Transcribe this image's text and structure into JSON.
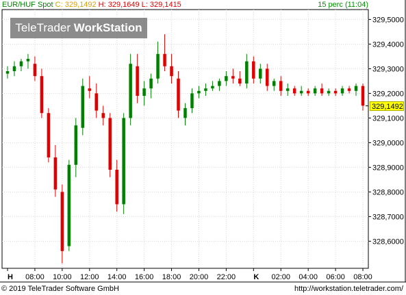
{
  "header": {
    "symbol": "EUR/HUF Spot",
    "close_label": "C:",
    "close_value": "329,1492",
    "high_label": "H:",
    "high_value": "329,1649",
    "low_label": "L:",
    "low_value": "329,1415",
    "interval": "15 perc (11:04)"
  },
  "logo": {
    "part1": "TeleTrader",
    "part2": "WorkStation"
  },
  "footer": {
    "copyright": "© 2019 TeleTrader Software GmbH",
    "url": "http://workstation.teletrader.com/"
  },
  "colors": {
    "up": "#008000",
    "down": "#e00000",
    "grid": "#d8d8d8",
    "last_price_bg": "#ffff00"
  },
  "chart_data": {
    "type": "candlestick",
    "interval": "15 perc",
    "y_ticks": [
      "329,5000",
      "329,4000",
      "329,3000",
      "329,2000",
      "329,1000",
      "329,0000",
      "328,9000",
      "328,8000",
      "328,7000",
      "328,6000"
    ],
    "ylim": [
      328.49,
      329.54
    ],
    "last_price": "329,1492",
    "x_ticks": [
      "H",
      "08:00",
      "10:00",
      "12:00",
      "14:00",
      "16:00",
      "18:00",
      "20:00",
      "22:00",
      "K",
      "02:00",
      "04:00",
      "06:00",
      "08:00"
    ],
    "candles": [
      {
        "o": 329.28,
        "h": 329.31,
        "l": 329.26,
        "c": 329.29
      },
      {
        "o": 329.29,
        "h": 329.33,
        "l": 329.27,
        "c": 329.31
      },
      {
        "o": 329.31,
        "h": 329.34,
        "l": 329.29,
        "c": 329.33
      },
      {
        "o": 329.33,
        "h": 329.36,
        "l": 329.3,
        "c": 329.34
      },
      {
        "o": 329.32,
        "h": 329.35,
        "l": 329.25,
        "c": 329.27
      },
      {
        "o": 329.27,
        "h": 329.3,
        "l": 329.1,
        "c": 329.12
      },
      {
        "o": 329.12,
        "h": 329.14,
        "l": 328.92,
        "c": 328.94
      },
      {
        "o": 328.94,
        "h": 328.99,
        "l": 328.78,
        "c": 328.81
      },
      {
        "o": 328.8,
        "h": 328.83,
        "l": 328.51,
        "c": 328.56
      },
      {
        "o": 328.58,
        "h": 328.93,
        "l": 328.56,
        "c": 328.91
      },
      {
        "o": 328.91,
        "h": 329.1,
        "l": 328.86,
        "c": 329.07
      },
      {
        "o": 329.06,
        "h": 329.26,
        "l": 329.03,
        "c": 329.23
      },
      {
        "o": 329.22,
        "h": 329.27,
        "l": 329.18,
        "c": 329.21
      },
      {
        "o": 329.2,
        "h": 329.24,
        "l": 329.1,
        "c": 329.13
      },
      {
        "o": 329.12,
        "h": 329.15,
        "l": 329.07,
        "c": 329.1
      },
      {
        "o": 329.1,
        "h": 329.12,
        "l": 328.86,
        "c": 328.89
      },
      {
        "o": 328.89,
        "h": 328.93,
        "l": 328.72,
        "c": 328.75
      },
      {
        "o": 328.75,
        "h": 329.12,
        "l": 328.71,
        "c": 329.1
      },
      {
        "o": 329.1,
        "h": 329.36,
        "l": 329.07,
        "c": 329.32
      },
      {
        "o": 329.31,
        "h": 329.36,
        "l": 329.16,
        "c": 329.19
      },
      {
        "o": 329.19,
        "h": 329.25,
        "l": 329.15,
        "c": 329.22
      },
      {
        "o": 329.22,
        "h": 329.28,
        "l": 329.18,
        "c": 329.26
      },
      {
        "o": 329.26,
        "h": 329.41,
        "l": 329.24,
        "c": 329.36
      },
      {
        "o": 329.36,
        "h": 329.44,
        "l": 329.29,
        "c": 329.31
      },
      {
        "o": 329.31,
        "h": 329.36,
        "l": 329.24,
        "c": 329.27
      },
      {
        "o": 329.26,
        "h": 329.29,
        "l": 329.1,
        "c": 329.13
      },
      {
        "o": 329.1,
        "h": 329.16,
        "l": 329.07,
        "c": 329.14
      },
      {
        "o": 329.14,
        "h": 329.22,
        "l": 329.12,
        "c": 329.2
      },
      {
        "o": 329.2,
        "h": 329.23,
        "l": 329.18,
        "c": 329.21
      },
      {
        "o": 329.21,
        "h": 329.24,
        "l": 329.19,
        "c": 329.22
      },
      {
        "o": 329.22,
        "h": 329.25,
        "l": 329.21,
        "c": 329.23
      },
      {
        "o": 329.23,
        "h": 329.26,
        "l": 329.21,
        "c": 329.25
      },
      {
        "o": 329.25,
        "h": 329.29,
        "l": 329.23,
        "c": 329.27
      },
      {
        "o": 329.27,
        "h": 329.3,
        "l": 329.24,
        "c": 329.26
      },
      {
        "o": 329.26,
        "h": 329.29,
        "l": 329.23,
        "c": 329.24
      },
      {
        "o": 329.24,
        "h": 329.36,
        "l": 329.22,
        "c": 329.33
      },
      {
        "o": 329.33,
        "h": 329.35,
        "l": 329.24,
        "c": 329.26
      },
      {
        "o": 329.26,
        "h": 329.32,
        "l": 329.24,
        "c": 329.3
      },
      {
        "o": 329.3,
        "h": 329.32,
        "l": 329.21,
        "c": 329.23
      },
      {
        "o": 329.23,
        "h": 329.26,
        "l": 329.21,
        "c": 329.25
      },
      {
        "o": 329.25,
        "h": 329.27,
        "l": 329.19,
        "c": 329.21
      },
      {
        "o": 329.21,
        "h": 329.24,
        "l": 329.19,
        "c": 329.22
      },
      {
        "o": 329.22,
        "h": 329.23,
        "l": 329.19,
        "c": 329.2
      },
      {
        "o": 329.2,
        "h": 329.23,
        "l": 329.19,
        "c": 329.21
      },
      {
        "o": 329.21,
        "h": 329.22,
        "l": 329.19,
        "c": 329.2
      },
      {
        "o": 329.2,
        "h": 329.23,
        "l": 329.19,
        "c": 329.22
      },
      {
        "o": 329.22,
        "h": 329.24,
        "l": 329.19,
        "c": 329.2
      },
      {
        "o": 329.2,
        "h": 329.22,
        "l": 329.19,
        "c": 329.21
      },
      {
        "o": 329.21,
        "h": 329.22,
        "l": 329.19,
        "c": 329.2
      },
      {
        "o": 329.2,
        "h": 329.23,
        "l": 329.19,
        "c": 329.22
      },
      {
        "o": 329.22,
        "h": 329.23,
        "l": 329.2,
        "c": 329.21
      },
      {
        "o": 329.21,
        "h": 329.24,
        "l": 329.19,
        "c": 329.23
      },
      {
        "o": 329.23,
        "h": 329.24,
        "l": 329.13,
        "c": 329.15
      }
    ]
  }
}
